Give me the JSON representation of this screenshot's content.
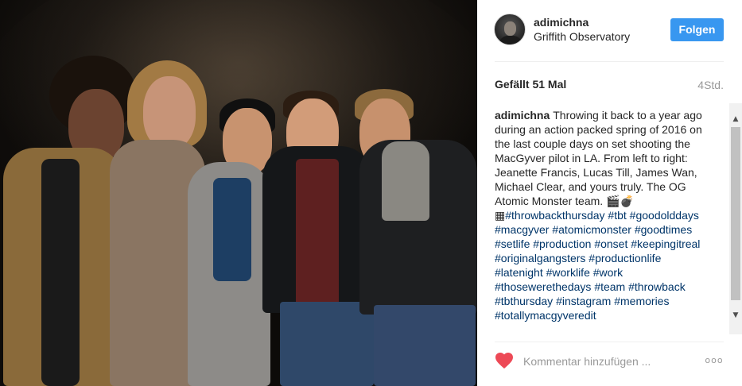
{
  "post": {
    "username": "adimichna",
    "location": "Griffith Observatory",
    "follow_label": "Folgen",
    "likes": "Gefällt 51 Mal",
    "time_ago": "4Std.",
    "caption": {
      "username": "adimichna",
      "text": "Throwing it back to a year ago during an action packed spring of 2016 on the last couple days on set shooting the MacGyver pilot in LA. From left to right: Jeanette Francis, Lucas Till, James Wan, Michael Clear, and yours truly. The OG Atomic Monster team.",
      "emojis": "🎬💣▦",
      "hashtags": [
        "#throwbackthursday",
        "#tbt",
        "#goodolddays",
        "#macgyver",
        "#atomicmonster",
        "#goodtimes",
        "#setlife",
        "#production",
        "#onset",
        "#keepingitreal",
        "#originalgangsters",
        "#productionlife",
        "#latenight",
        "#worklife",
        "#work",
        "#thosewerethedays",
        "#team",
        "#throwback",
        "#tbthursday",
        "#instagram",
        "#memories",
        "#totallymacgyveredit"
      ]
    },
    "comment_placeholder": "Kommentar hinzufügen ...",
    "more_label": "ooo"
  },
  "scrollbar": {
    "up_glyph": "▲",
    "down_glyph": "▼"
  },
  "colors": {
    "accent": "#3897f0",
    "like_heart": "#ed4956",
    "hashtag": "#003569",
    "muted": "#999999"
  },
  "icons": {
    "like": "heart-icon",
    "more": "more-options-icon"
  }
}
